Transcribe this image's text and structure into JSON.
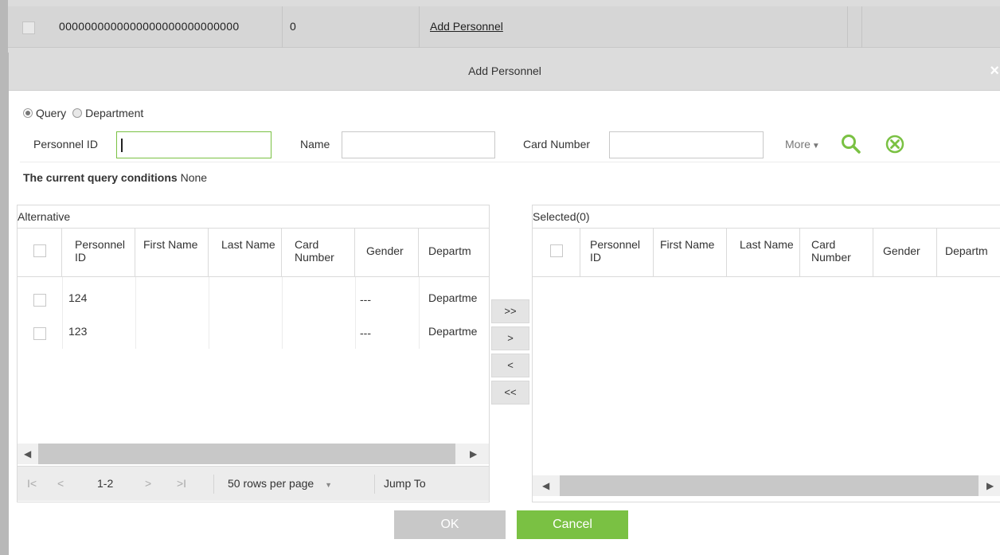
{
  "background_row": {
    "col1": "0000000000000000000000000000",
    "col2": "0",
    "link": "Add Personnel"
  },
  "dialog": {
    "title": "Add Personnel",
    "close_glyph": "×",
    "radio_query": "Query",
    "radio_department": "Department",
    "filters": {
      "personnel_id_label": "Personnel ID",
      "personnel_id_value": "",
      "name_label": "Name",
      "name_value": "",
      "card_number_label": "Card Number",
      "card_number_value": "",
      "more_label": "More",
      "more_arrow": "▼"
    },
    "query_conditions_label": "The current query conditions",
    "query_conditions_value": "None",
    "alternative": {
      "title": "Alternative",
      "columns": [
        "Personnel ID",
        "First Name",
        "Last Name",
        "Card Number",
        "Gender",
        "Departm"
      ],
      "rows": [
        {
          "personnel_id": "124",
          "first_name": "",
          "last_name": "",
          "card_number": "",
          "gender": "---",
          "department": "Departme"
        },
        {
          "personnel_id": "123",
          "first_name": "",
          "last_name": "",
          "card_number": "",
          "gender": "---",
          "department": "Departme"
        }
      ],
      "pager": {
        "first": "I<",
        "prev": "<",
        "range": "1-2",
        "next": ">",
        "last": ">I",
        "rows_per_page": "50 rows per page",
        "dropdown_arrow": "▼",
        "jump_to": "Jump To"
      }
    },
    "selected": {
      "title": "Selected(0)",
      "columns": [
        "Personnel ID",
        "First Name",
        "Last Name",
        "Card Number",
        "Gender",
        "Departm"
      ]
    },
    "move_buttons": {
      "all_right": ">>",
      "right": ">",
      "left": "<",
      "all_left": "<<"
    },
    "scroll_left": "◀",
    "scroll_right": "▶",
    "ok_label": "OK",
    "cancel_label": "Cancel"
  },
  "colors": {
    "accent_green": "#7ac143",
    "title_bar": "#dcdcdc",
    "ok_disabled": "#c8c8c8"
  }
}
